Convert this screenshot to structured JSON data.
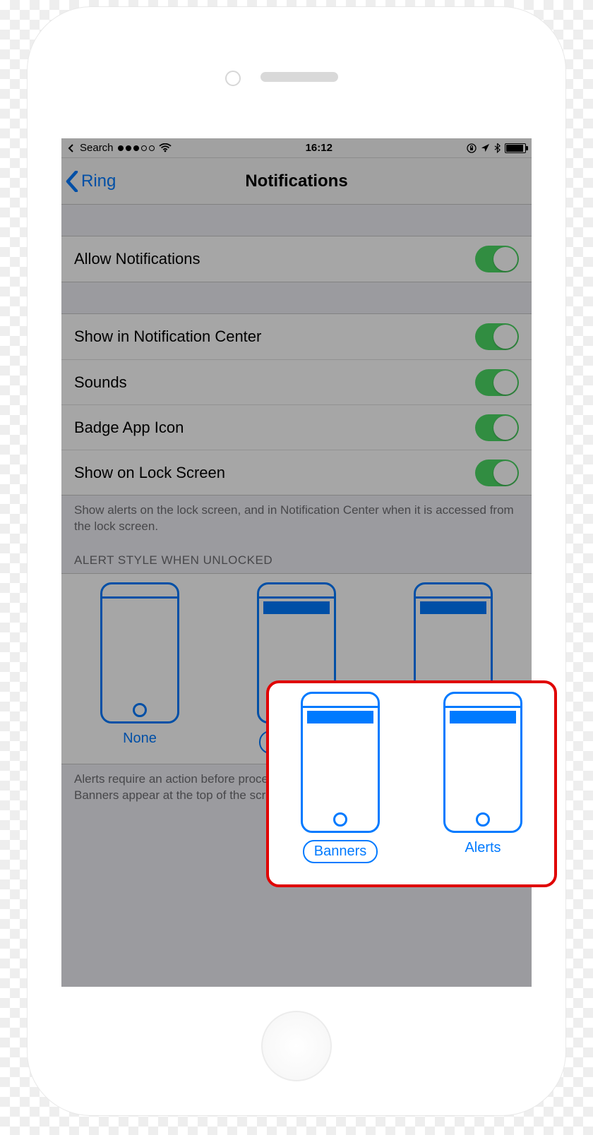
{
  "status_bar": {
    "back_to_app": "Search",
    "time": "16:12"
  },
  "nav": {
    "back_label": "Ring",
    "title": "Notifications"
  },
  "rows": {
    "allow": "Allow Notifications",
    "show_nc": "Show in Notification Center",
    "sounds": "Sounds",
    "badge": "Badge App Icon",
    "lock": "Show on Lock Screen"
  },
  "footer1": "Show alerts on the lock screen, and in Notification Center when it is accessed from the lock screen.",
  "section_header": "ALERT STYLE WHEN UNLOCKED",
  "alert_styles": {
    "none": "None",
    "banners": "Banners",
    "alerts": "Alerts"
  },
  "footer2_line1": "Alerts require an action before proceeding.",
  "footer2_line2": "Banners appear at the top of the screen and go away automatically."
}
